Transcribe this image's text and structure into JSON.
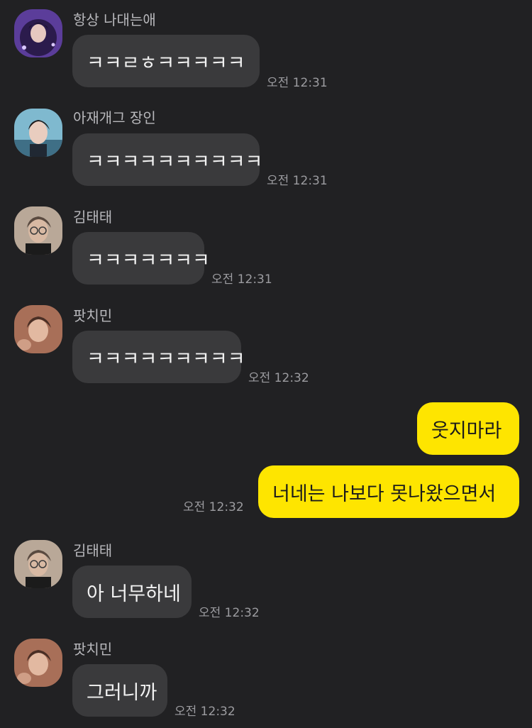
{
  "messages": [
    {
      "sender": "항상 나대는애",
      "text": "ㅋㅋㄹㅎㅋㅋㅋㅋㅋ",
      "time": "오전 12:31",
      "avatar_icon": "profile-photo-purple-icon"
    },
    {
      "sender": "아재개그 장인",
      "text": "ㅋㅋㅋㅋㅋㅋㅋㅋㅋㅋ",
      "time": "오전 12:31",
      "avatar_icon": "profile-photo-blue-icon"
    },
    {
      "sender": "김태태",
      "text": "ㅋㅋㅋㅋㅋㅋㅋ",
      "time": "오전 12:31",
      "avatar_icon": "profile-photo-glasses-icon"
    },
    {
      "sender": "팟치민",
      "text": "ㅋㅋㅋㅋㅋㅋㅋㅋㅋ",
      "time": "오전 12:32",
      "avatar_icon": "profile-photo-warm-icon"
    },
    {
      "sender": "",
      "text": "웃지마라",
      "time": "",
      "mine": true
    },
    {
      "sender": "",
      "text": "너네는 나보다 못나왔으면서",
      "time": "오전 12:32",
      "mine": true
    },
    {
      "sender": "김태태",
      "text": "아 너무하네",
      "time": "오전 12:32",
      "avatar_icon": "profile-photo-glasses-icon"
    },
    {
      "sender": "팟치민",
      "text": "그러니까",
      "time": "오전 12:32",
      "avatar_icon": "profile-photo-warm-icon"
    }
  ],
  "colors": {
    "background": "#212123",
    "incoming_bubble": "#3a3a3c",
    "outgoing_bubble": "#fee500"
  }
}
